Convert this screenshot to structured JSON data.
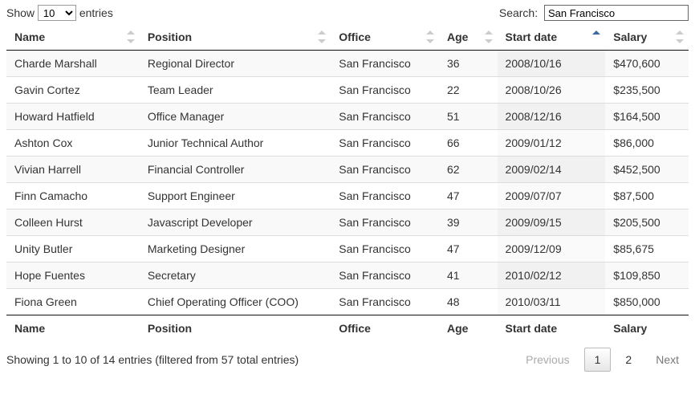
{
  "length": {
    "prefix": "Show",
    "suffix": "entries",
    "value": "10",
    "options": [
      "10",
      "25",
      "50",
      "100"
    ]
  },
  "search": {
    "label": "Search:",
    "value": "San Francisco"
  },
  "columns": [
    {
      "key": "name",
      "label": "Name"
    },
    {
      "key": "position",
      "label": "Position"
    },
    {
      "key": "office",
      "label": "Office"
    },
    {
      "key": "age",
      "label": "Age"
    },
    {
      "key": "start_date",
      "label": "Start date",
      "sorted": "asc"
    },
    {
      "key": "salary",
      "label": "Salary"
    }
  ],
  "rows": [
    {
      "name": "Charde Marshall",
      "position": "Regional Director",
      "office": "San Francisco",
      "age": "36",
      "start_date": "2008/10/16",
      "salary": "$470,600"
    },
    {
      "name": "Gavin Cortez",
      "position": "Team Leader",
      "office": "San Francisco",
      "age": "22",
      "start_date": "2008/10/26",
      "salary": "$235,500"
    },
    {
      "name": "Howard Hatfield",
      "position": "Office Manager",
      "office": "San Francisco",
      "age": "51",
      "start_date": "2008/12/16",
      "salary": "$164,500"
    },
    {
      "name": "Ashton Cox",
      "position": "Junior Technical Author",
      "office": "San Francisco",
      "age": "66",
      "start_date": "2009/01/12",
      "salary": "$86,000"
    },
    {
      "name": "Vivian Harrell",
      "position": "Financial Controller",
      "office": "San Francisco",
      "age": "62",
      "start_date": "2009/02/14",
      "salary": "$452,500"
    },
    {
      "name": "Finn Camacho",
      "position": "Support Engineer",
      "office": "San Francisco",
      "age": "47",
      "start_date": "2009/07/07",
      "salary": "$87,500"
    },
    {
      "name": "Colleen Hurst",
      "position": "Javascript Developer",
      "office": "San Francisco",
      "age": "39",
      "start_date": "2009/09/15",
      "salary": "$205,500"
    },
    {
      "name": "Unity Butler",
      "position": "Marketing Designer",
      "office": "San Francisco",
      "age": "47",
      "start_date": "2009/12/09",
      "salary": "$85,675"
    },
    {
      "name": "Hope Fuentes",
      "position": "Secretary",
      "office": "San Francisco",
      "age": "41",
      "start_date": "2010/02/12",
      "salary": "$109,850"
    },
    {
      "name": "Fiona Green",
      "position": "Chief Operating Officer (COO)",
      "office": "San Francisco",
      "age": "48",
      "start_date": "2010/03/11",
      "salary": "$850,000"
    }
  ],
  "info": "Showing 1 to 10 of 14 entries (filtered from 57 total entries)",
  "paginate": {
    "previous": "Previous",
    "next": "Next",
    "pages": [
      "1",
      "2"
    ],
    "current": "1"
  }
}
